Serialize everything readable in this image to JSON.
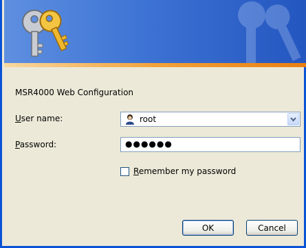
{
  "dialog": {
    "title": "MSR4000 Web Configuration"
  },
  "icons": {
    "banner": "keys-icon",
    "watermark": "keys-watermark-icon",
    "user": "user-icon",
    "dropdown": "chevron-down-icon"
  },
  "form": {
    "user_label_accel": "U",
    "user_label_rest": "ser name:",
    "user_value": "root",
    "password_label_accel": "P",
    "password_label_rest": "assword:",
    "password_value": "●●●●●●",
    "remember_accel": "R",
    "remember_rest": "emember my password",
    "remember_checked": false
  },
  "buttons": {
    "ok_label": "OK",
    "cancel_label": "Cancel"
  },
  "colors": {
    "banner_blue": "#3e74d4",
    "accent_orange": "#f2a23a",
    "dialog_bg": "#ece9d8",
    "frame_blue": "#0a52d6"
  }
}
